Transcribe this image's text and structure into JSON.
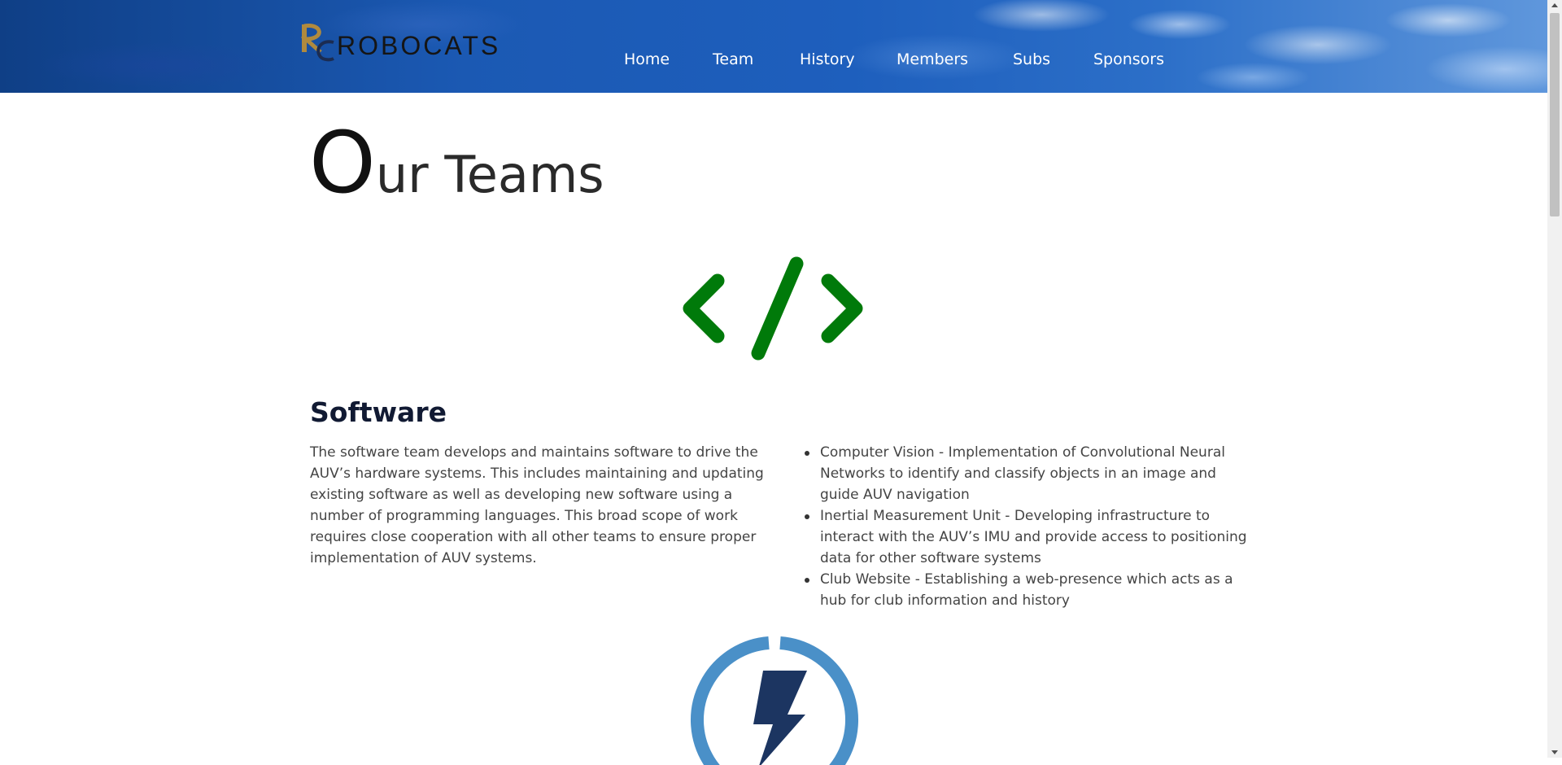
{
  "header": {
    "logo_text": "ROBOCATS",
    "logo_mark": "RC",
    "nav": [
      {
        "label": "Home"
      },
      {
        "label": "Team"
      },
      {
        "label": "History"
      },
      {
        "label": "Members"
      },
      {
        "label": "Subs"
      },
      {
        "label": "Sponsors"
      }
    ]
  },
  "page": {
    "title_initial": "O",
    "title_rest": "ur Teams"
  },
  "sections": [
    {
      "icon": "code-icon",
      "icon_color": "#007a0a",
      "heading": "Software",
      "description": "The software team develops and maintains software to drive the AUV’s hardware systems. This includes maintaining and updating existing software as well as developing new software using a number of programming languages. This broad scope of work requires close cooperation with all other teams to ensure proper implementation of AUV systems.",
      "focus_areas": [
        "Computer Vision - Implementation of Convolutional Neural Networks to identify and classify objects in an image and guide AUV navigation",
        "Inertial Measurement Unit - Developing infrastructure to interact with the AUV’s IMU and provide access to positioning data for other software systems",
        "Club Website - Establishing a web-presence which acts as a hub for club information and history"
      ]
    },
    {
      "icon": "lightning-bolt-icon",
      "icon_ring_color": "#4a90c8",
      "icon_bolt_color": "#1c3561"
    }
  ]
}
